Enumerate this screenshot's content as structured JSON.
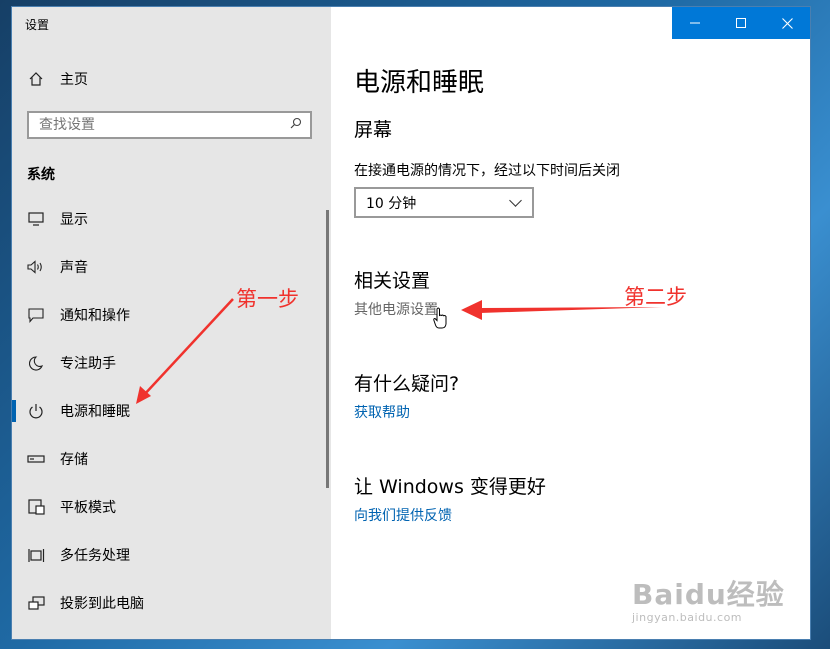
{
  "app": {
    "title": "设置",
    "window_controls": {
      "minimize": "—",
      "maximize": "☐",
      "close": "✕"
    }
  },
  "sidebar": {
    "home": {
      "label": "主页",
      "icon": "home-icon"
    },
    "search": {
      "placeholder": "查找设置",
      "icon": "search-icon"
    },
    "group_title": "系统",
    "items": [
      {
        "label": "显示",
        "icon": "monitor-icon"
      },
      {
        "label": "声音",
        "icon": "speaker-icon"
      },
      {
        "label": "通知和操作",
        "icon": "notification-icon"
      },
      {
        "label": "专注助手",
        "icon": "moon-icon"
      },
      {
        "label": "电源和睡眠",
        "icon": "power-icon",
        "active": true
      },
      {
        "label": "存储",
        "icon": "storage-icon"
      },
      {
        "label": "平板模式",
        "icon": "tablet-icon"
      },
      {
        "label": "多任务处理",
        "icon": "multitask-icon"
      },
      {
        "label": "投影到此电脑",
        "icon": "project-icon"
      }
    ]
  },
  "main": {
    "title": "电源和睡眠",
    "screen": {
      "heading": "屏幕",
      "description": "在接通电源的情况下，经过以下时间后关闭",
      "dropdown_value": "10 分钟"
    },
    "related": {
      "heading": "相关设置",
      "link": "其他电源设置"
    },
    "question": {
      "heading": "有什么疑问?",
      "link": "获取帮助"
    },
    "feedback": {
      "heading": "让 Windows 变得更好",
      "link": "向我们提供反馈"
    }
  },
  "annotations": {
    "step1": "第一步",
    "step2": "第二步",
    "color": "#f0322d"
  },
  "watermark": {
    "main": "Baidu经验",
    "sub": "jingyan.baidu.com"
  },
  "colors": {
    "accent": "#0078d7",
    "link": "#0063b1",
    "sidebar_bg": "#e6e6e6"
  }
}
